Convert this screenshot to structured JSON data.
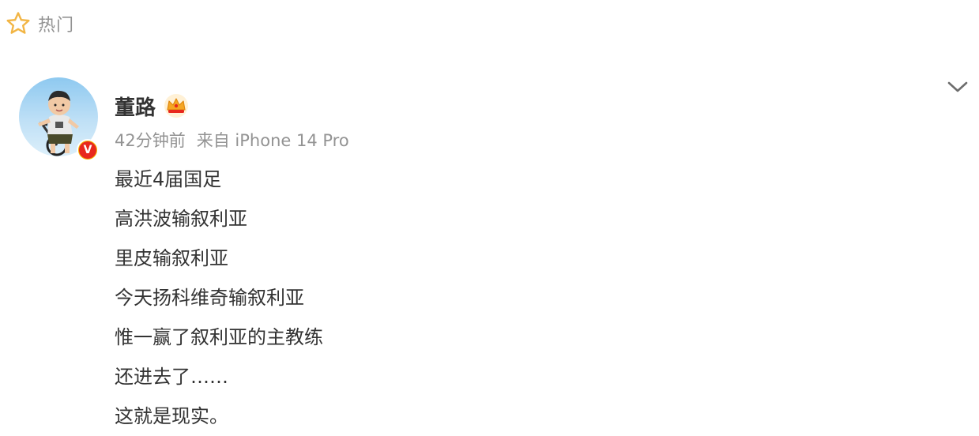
{
  "tab": {
    "icon": "star-outline-icon",
    "label": "热门"
  },
  "post": {
    "author": {
      "name": "董路",
      "avatar_icon": "avatar-child-on-bike",
      "verified_icon": "verified-v-badge-icon",
      "verified_label": "V",
      "member_icon": "crown-icon"
    },
    "time": "42分钟前",
    "source": "来自 iPhone 14 Pro",
    "menu_icon": "chevron-down-icon",
    "lines": [
      "最近4届国足",
      "高洪波输叙利亚",
      "里皮输叙利亚",
      "今天扬科维奇输叙利亚",
      "惟一赢了叙利亚的主教练",
      "还进去了……",
      "这就是现实。"
    ]
  },
  "colors": {
    "primary_text": "#333333",
    "secondary_text": "#939393",
    "star_icon": "#f2b544",
    "verified_badge": "#e8281d",
    "crown": "#f5a623"
  }
}
